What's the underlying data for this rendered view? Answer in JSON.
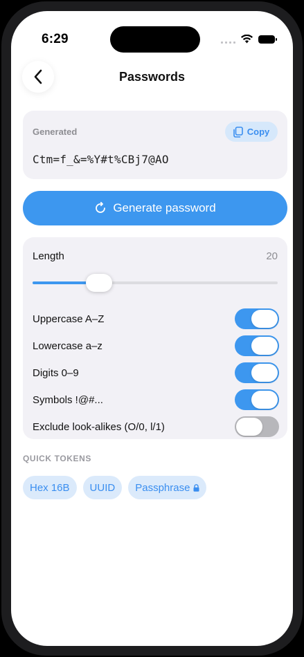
{
  "status_bar": {
    "time": "6:29"
  },
  "nav": {
    "title": "Passwords",
    "back_icon": "chevron-left-icon"
  },
  "generated": {
    "label": "Generated",
    "copy_label": "Copy",
    "copy_icon": "clipboard-icon",
    "value": "Ctm=f_&=%Y#t%CBj7@AO"
  },
  "generate_button": {
    "label": "Generate password",
    "icon": "refresh-icon"
  },
  "options": {
    "length": {
      "label": "Length",
      "value": "20",
      "slider_fraction": 0.27
    },
    "toggles": [
      {
        "label": "Uppercase A–Z",
        "on": true
      },
      {
        "label": "Lowercase a–z",
        "on": true
      },
      {
        "label": "Digits 0–9",
        "on": true
      },
      {
        "label": "Symbols !@#...",
        "on": true
      },
      {
        "label": "Exclude look-alikes (O/0, l/1)",
        "on": false
      }
    ]
  },
  "quick_tokens": {
    "header": "QUICK TOKENS",
    "chips": [
      {
        "label": "Hex 16B"
      },
      {
        "label": "UUID"
      },
      {
        "label": "Passphrase",
        "icon": "lock-icon"
      }
    ]
  },
  "colors": {
    "accent": "#3d97ef",
    "card_bg": "#f2f1f6",
    "chip_bg": "#dbeafb",
    "toggle_off": "#b7b7bb"
  }
}
